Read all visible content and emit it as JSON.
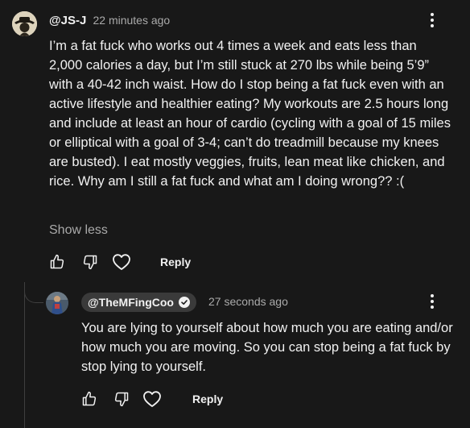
{
  "comment": {
    "author": "@JS-J",
    "time": "22 minutes ago",
    "text": "I’m a fat fuck who works out 4 times a week and eats less than 2,000 calories a day, but I’m still stuck at 270 lbs while being 5’9” with a 40-42 inch waist. How do I stop being a fat fuck even with an active lifestyle and healthier eating? My workouts are 2.5 hours long and include at least an hour of cardio (cycling with a goal of 15 miles or elliptical with a goal of 3-4; can’t do treadmill because my knees are busted). I eat mostly veggies, fruits, lean meat like chicken, and rice. Why am I still a fat fuck and what am I doing wrong?? :(",
    "show_less": "Show less",
    "reply_label": "Reply"
  },
  "reply": {
    "author": "@TheMFingCoo",
    "time": "27 seconds ago",
    "text": "You are lying to yourself about how much you are eating and/or how much you are moving. So you can stop being a fat fuck by stop lying to yourself.",
    "reply_label": "Reply"
  },
  "icons": [
    "like-icon",
    "dislike-icon",
    "heart-icon",
    "more-vertical-icon",
    "verified-icon"
  ],
  "colors": {
    "background": "#181818",
    "text": "#f1f1f1",
    "secondary": "#aaaaaa",
    "chip": "#3a3a3a"
  }
}
